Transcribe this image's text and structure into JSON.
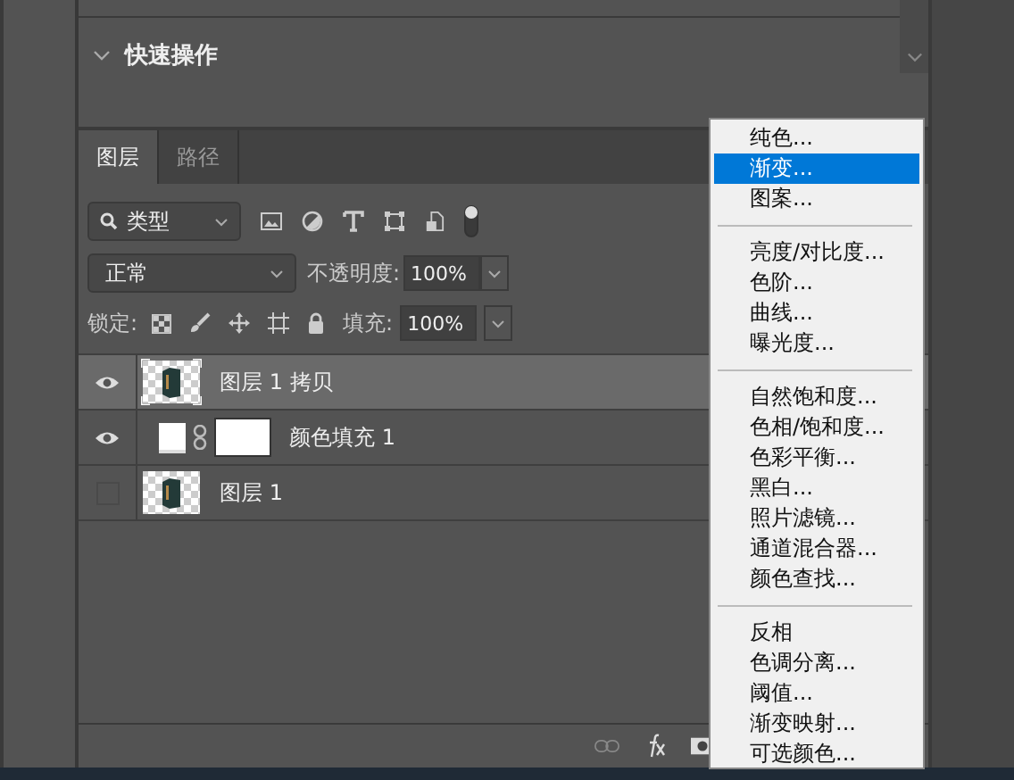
{
  "quick_actions": {
    "title": "快速操作",
    "expanded": true
  },
  "tabs": [
    {
      "label": "图层",
      "selected": true
    },
    {
      "label": "路径",
      "selected": false
    }
  ],
  "filter": {
    "value": "类型",
    "on": true
  },
  "blend_mode": {
    "value": "正常"
  },
  "opacity": {
    "label": "不透明度:",
    "value": "100%"
  },
  "lock": {
    "label": "锁定:"
  },
  "fill": {
    "label": "填充:",
    "value": "100%"
  },
  "layers": [
    {
      "kind": "image",
      "name": "图层 1 拷贝",
      "visible": true,
      "selected": true
    },
    {
      "kind": "fill",
      "name": "颜色填充 1",
      "visible": true,
      "selected": false
    },
    {
      "kind": "image",
      "name": "图层 1",
      "visible": false,
      "selected": false
    }
  ],
  "menu": [
    [
      {
        "label": "纯色...",
        "selected": false
      },
      {
        "label": "渐变...",
        "selected": true
      },
      {
        "label": "图案...",
        "selected": false
      }
    ],
    [
      {
        "label": "亮度/对比度...",
        "selected": false
      },
      {
        "label": "色阶...",
        "selected": false
      },
      {
        "label": "曲线...",
        "selected": false
      },
      {
        "label": "曝光度...",
        "selected": false
      }
    ],
    [
      {
        "label": "自然饱和度...",
        "selected": false
      },
      {
        "label": "色相/饱和度...",
        "selected": false
      },
      {
        "label": "色彩平衡...",
        "selected": false
      },
      {
        "label": "黑白...",
        "selected": false
      },
      {
        "label": "照片滤镜...",
        "selected": false
      },
      {
        "label": "通道混合器...",
        "selected": false
      },
      {
        "label": "颜色查找...",
        "selected": false
      }
    ],
    [
      {
        "label": "反相",
        "selected": false
      },
      {
        "label": "色调分离...",
        "selected": false
      },
      {
        "label": "阈值...",
        "selected": false
      },
      {
        "label": "渐变映射...",
        "selected": false
      },
      {
        "label": "可选颜色...",
        "selected": false
      }
    ]
  ]
}
